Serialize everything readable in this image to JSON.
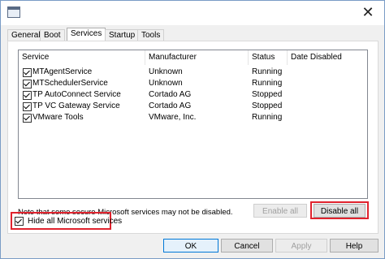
{
  "tabs": [
    {
      "label": "General"
    },
    {
      "label": "Boot"
    },
    {
      "label": "Services"
    },
    {
      "label": "Startup"
    },
    {
      "label": "Tools"
    }
  ],
  "active_tab": "Services",
  "table": {
    "columns": [
      "Service",
      "Manufacturer",
      "Status",
      "Date Disabled"
    ],
    "rows": [
      {
        "service": "MTAgentService",
        "manufacturer": "Unknown",
        "status": "Running",
        "date_disabled": "",
        "checked": true
      },
      {
        "service": "MTSchedulerService",
        "manufacturer": "Unknown",
        "status": "Running",
        "date_disabled": "",
        "checked": true
      },
      {
        "service": "TP AutoConnect Service",
        "manufacturer": "Cortado AG",
        "status": "Stopped",
        "date_disabled": "",
        "checked": true
      },
      {
        "service": "TP VC Gateway Service",
        "manufacturer": "Cortado AG",
        "status": "Stopped",
        "date_disabled": "",
        "checked": true
      },
      {
        "service": "VMware Tools",
        "manufacturer": "VMware, Inc.",
        "status": "Running",
        "date_disabled": "",
        "checked": true
      }
    ]
  },
  "note": "Note that some secure Microsoft services may not be disabled.",
  "buttons": {
    "enable_all": "Enable all",
    "disable_all": "Disable all",
    "ok": "OK",
    "cancel": "Cancel",
    "apply": "Apply",
    "help": "Help"
  },
  "hide_ms": {
    "label": "Hide all Microsoft services",
    "checked": true
  },
  "icons": {
    "close": "close-icon",
    "app": "msconfig-icon"
  },
  "colors": {
    "highlight": "#e0232e",
    "accent": "#0078d7"
  }
}
